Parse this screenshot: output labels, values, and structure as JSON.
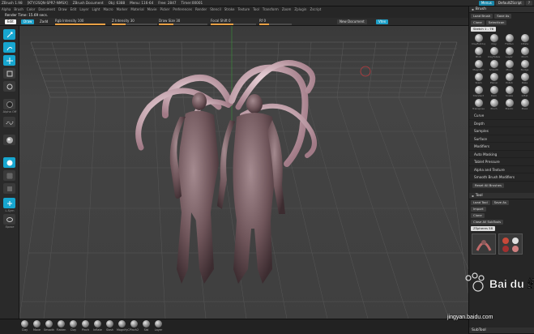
{
  "app": {
    "title_parts": [
      "ZBrush 1.98 ",
      "[KTY/2SQN-SPR7-NMSX]",
      "ZBrush Document",
      "Obj: 6388",
      "Menu: 116-64",
      "Free: 2847",
      "Timer:00001"
    ],
    "menu_btn": "Menus",
    "script_btn": "DefaultZScript",
    "help_icon": "help-icon"
  },
  "menubar": {
    "items": [
      "Alpha",
      "Brush",
      "Color",
      "Document",
      "Draw",
      "Edit",
      "Layer",
      "Light",
      "Macro",
      "Marker",
      "Material",
      "Movie",
      "Picker",
      "Preferences",
      "Render",
      "Stencil",
      "Stroke",
      "Texture",
      "Tool",
      "Transform",
      "Zoom",
      "Zplugin",
      "Zscript"
    ]
  },
  "render_time": "Render Time: 15.69 secs.",
  "toolbar": {
    "edit": "Edit",
    "draw": "Draw",
    "zadd": "Zadd",
    "intensity_label": "Rgb Intensity 100",
    "z_intensity_label": "Z Intensity 30",
    "draw_size_label": "Draw Size 30",
    "focal_label": "Focal Shift 0",
    "gyro_label": "Rf 0",
    "new_doc": "New Document",
    "active_btn": "Vtex",
    "levels": {
      "rgb_intensity": 1.0,
      "z_intensity": 0.3,
      "draw_size": 0.3,
      "focal_shift": 0.5
    }
  },
  "left_tools": [
    {
      "name": "edit-icon",
      "active": true
    },
    {
      "name": "draw-icon",
      "active": true
    },
    {
      "name": "move-icon",
      "active": true
    },
    {
      "name": "scale-icon",
      "active": false
    },
    {
      "name": "rotate-icon",
      "active": false
    },
    {
      "name": "alpha-icon",
      "active": false,
      "label": "Alpha Off"
    },
    {
      "name": "stroke-icon",
      "active": false
    },
    {
      "name": "material-icon",
      "active": false
    },
    {
      "name": "texture-icon",
      "active": true
    },
    {
      "name": "grid-icon",
      "active": false
    },
    {
      "name": "color-icon",
      "active": false
    },
    {
      "name": "symmetry-icon",
      "active": true,
      "label": "L.Sym"
    },
    {
      "name": "lasso-icon",
      "active": false,
      "label": "Xpose"
    }
  ],
  "bottom_brushes": [
    "Clay",
    "Move",
    "Smooth",
    "Flatten",
    "Clay",
    "Pinch",
    "Inflate",
    "Slash",
    "MagnifyC",
    "Pinch2",
    "Std",
    "Layer"
  ],
  "brush_panel": {
    "title": "Brush",
    "load": "Load Brush",
    "save": "Save As",
    "clone": "Clone",
    "selection": "SelectIcon",
    "sketch": "Sketch 1 - 76",
    "items": [
      "ClayBuildup",
      "Clay",
      "Flatten",
      "Inflate",
      "Blob",
      "ClayTubes",
      "Layer",
      "Pinch",
      "MagnifyC",
      "Smooth",
      "Move",
      "Nudge",
      "Slash",
      "Planar",
      "Polish",
      "Rake",
      "Standard",
      "Dam",
      "Snake",
      "Inflat",
      "Transpose",
      "Pinch",
      "Elastic",
      "Mask"
    ],
    "sub_items": [
      "Curve",
      "Depth",
      "Samples",
      "Surface",
      "Modifiers",
      "Auto Masking",
      "Tablet Pressure",
      "Alpha and Texture",
      "Smooth Brush Modifiers"
    ],
    "reset": "Reset All Brushes"
  },
  "tool_panel": {
    "title": "Tool",
    "load": "Load Tool",
    "save": "Save As",
    "import": "Import",
    "clone": "Clone",
    "close_all": "Close All SubTools",
    "spheres": "ZSpheres 58",
    "lower_label": "SubTool"
  },
  "watermark": {
    "text": "jingyan.baidu.com",
    "logo": "Bai du 经验"
  },
  "colors": {
    "accent_cyan": "#17a6cf",
    "slider_orange": "#e9a045",
    "viewport_bg": "#3c3c3c"
  }
}
